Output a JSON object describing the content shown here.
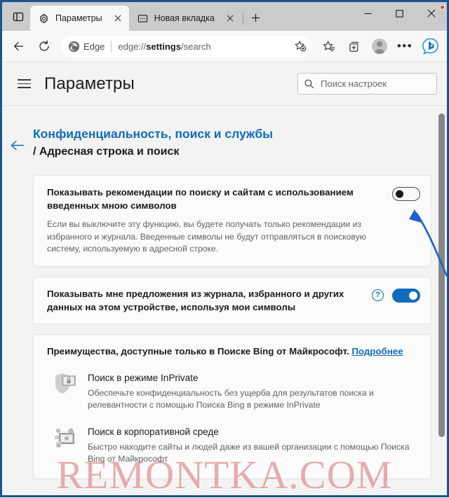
{
  "browser": {
    "tabs": [
      {
        "title": "Параметры",
        "icon": "gear-icon",
        "active": true
      },
      {
        "title": "Новая вкладка",
        "icon": "window-icon",
        "active": false
      }
    ],
    "new_tab_label": "+",
    "window_controls": {
      "minimize": "–",
      "maximize": "□",
      "close": "✕"
    },
    "omnibox": {
      "brand": "Edge",
      "url_prefix": "edge://",
      "url_bold": "settings",
      "url_suffix": "/search",
      "full_url": "edge://settings/search"
    },
    "toolbar_icons": [
      "back-icon",
      "refresh-icon",
      "add-favorite-icon",
      "favorites-icon",
      "collections-icon",
      "profile-icon",
      "more-settings-icon",
      "bing-copilot-icon"
    ]
  },
  "settings": {
    "header": {
      "menu_icon": "hamburger-icon",
      "title": "Параметры",
      "search_placeholder": "Поиск настроек",
      "search_value": "",
      "search_icon": "search-icon"
    },
    "breadcrumb": {
      "back_icon": "back-arrow-icon",
      "parent": "Конфиденциальность, поиск и службы",
      "current": "/ Адресная строка и поиск"
    },
    "rows": [
      {
        "label": "Показывать рекомендации по поиску и сайтам с использованием введенных мною символов",
        "description": "Если вы выключите эту функцию, вы будете получать только рекомендации из избранного и журнала. Введенные символы не будут отправляться в поисковую систему, используемую в адресной строке.",
        "toggle_state": "off",
        "has_help": false
      },
      {
        "label": "Показывать мне предложения из журнала, избранного и других данных на этом устройстве, используя мои символы",
        "description": "",
        "toggle_state": "on",
        "has_help": true,
        "help_icon": "question-mark-icon"
      }
    ],
    "bing_section": {
      "title": "Преимущества, доступные только в Поиске Bing от Майкрософт.",
      "more_link": "Подробнее",
      "benefits": [
        {
          "icon": "shield-lock-icon",
          "title": "Поиск в режиме InPrivate",
          "description": "Обеспечьте конфиденциальность без ущерба для результатов поиска и релевантности с помощью Поиска Bing в режиме InPrivate"
        },
        {
          "icon": "enterprise-search-icon",
          "title": "Поиск в корпоративной среде",
          "description": "Быстро находите сайты и людей даже из вашей организации с помощью Поиска Bing от Майкрософт"
        }
      ]
    }
  },
  "annotation": {
    "arrow_color": "#1a63c9",
    "points_to": "first-setting-toggle"
  },
  "watermark": {
    "text": "REMONTKA.COM",
    "color": "#d66a6e"
  },
  "colors": {
    "accent": "#0f6cbd",
    "window_border": "#19558f",
    "tabstrip_bg": "#cbcbcb",
    "page_bg": "#f3f3f3",
    "card_bg": "#fbfbfb"
  }
}
